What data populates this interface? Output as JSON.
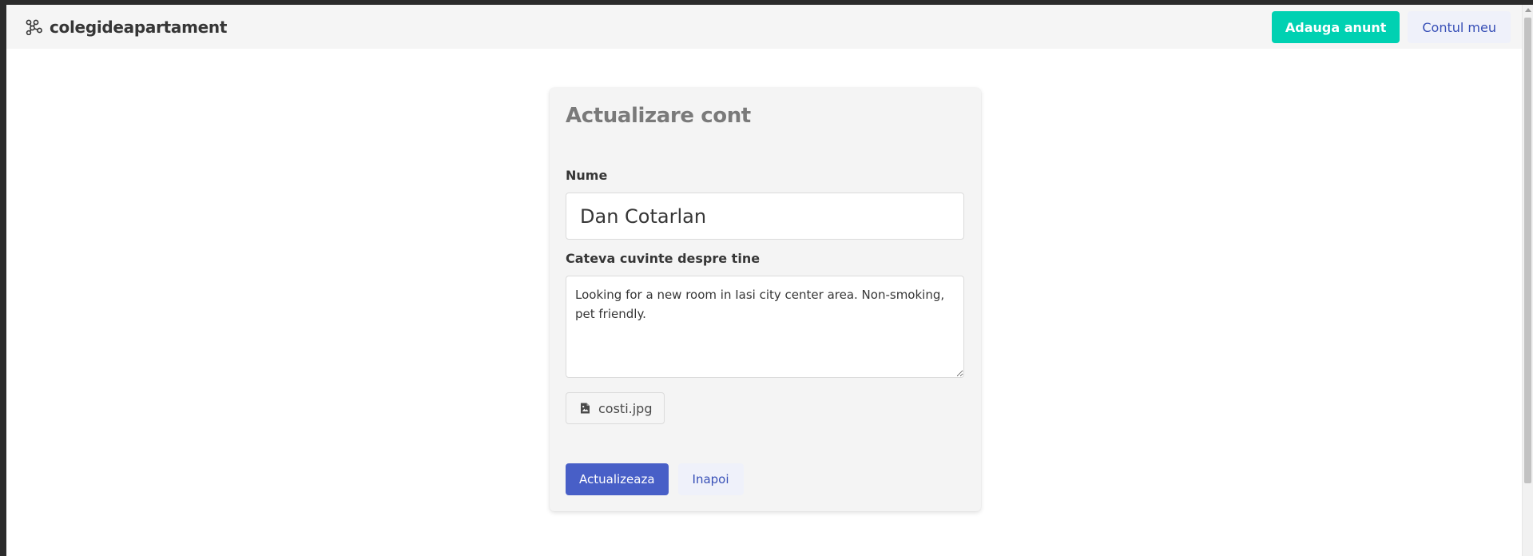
{
  "navbar": {
    "brand_name": "colegideapartament",
    "brand_icon": "network-nodes-icon",
    "add_listing_label": "Adauga anunt",
    "account_label": "Contul meu"
  },
  "form": {
    "title": "Actualizare cont",
    "name_label": "Nume",
    "name_value": "Dan Cotarlan",
    "about_label": "Cateva cuvinte despre tine",
    "about_value": "Looking for a new room in Iasi city center area. Non-smoking, pet friendly.",
    "file_name": "costi.jpg",
    "file_icon": "image-file-icon",
    "submit_label": "Actualizeaza",
    "back_label": "Inapoi"
  },
  "colors": {
    "accent_teal": "#00d1b2",
    "primary_blue": "#485fc7",
    "light_link_bg": "#eff1fa",
    "link_text": "#3850b7"
  }
}
